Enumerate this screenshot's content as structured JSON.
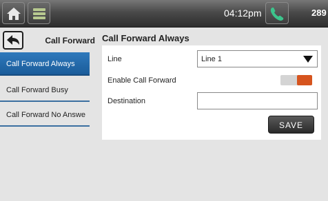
{
  "topbar": {
    "time": "04:12pm",
    "extension": "289"
  },
  "sidebar": {
    "title": "Call Forward",
    "items": [
      {
        "label": "Call Forward Always",
        "active": true
      },
      {
        "label": "Call Forward Busy",
        "active": false
      },
      {
        "label": "Call Forward No Answe",
        "active": false
      }
    ]
  },
  "main": {
    "title": "Call Forward Always",
    "line_label": "Line",
    "line_value": "Line 1",
    "enable_label": "Enable Call Forward",
    "enable_on": true,
    "destination_label": "Destination",
    "destination_value": "",
    "save_label": "SAVE"
  },
  "colors": {
    "accent": "#2f79bc",
    "toggle_on": "#d6541e"
  },
  "icons": [
    "home-icon",
    "menu-icon",
    "phone-icon",
    "back-arrow-icon",
    "dropdown-arrow-icon"
  ]
}
